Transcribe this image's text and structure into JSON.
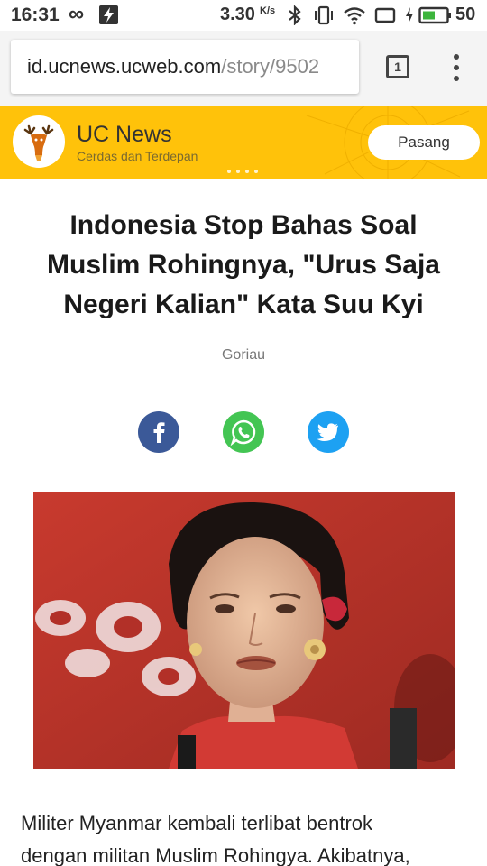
{
  "status_bar": {
    "time": "16:31",
    "network_speed": "3.30",
    "network_speed_unit": "K/s",
    "battery_percent": "50"
  },
  "browser": {
    "url_host": "id.ucnews.ucweb.com",
    "url_path": "/story/9502",
    "tab_count": "1"
  },
  "banner": {
    "app_name": "UC News",
    "tagline": "Cerdas dan Terdepan",
    "install_label": "Pasang",
    "background_color": "#ffc20a"
  },
  "article": {
    "headline_lines": [
      "Indonesia Stop Bahas Soal",
      "Muslim Rohingnya, \"Urus Saja",
      "Negeri Kalian\" Kata Suu Kyi"
    ],
    "source": "Goriau",
    "share": [
      {
        "name": "facebook",
        "icon": "facebook-icon",
        "color": "#3b5998"
      },
      {
        "name": "whatsapp",
        "icon": "whatsapp-icon",
        "color": "#43c553"
      },
      {
        "name": "twitter",
        "icon": "twitter-icon",
        "color": "#1da1f2"
      }
    ],
    "body_lines": [
      "Militer Myanmar kembali terlibat bentrok",
      "dengan militan Muslim Rohingya. Akibatnya,"
    ]
  }
}
